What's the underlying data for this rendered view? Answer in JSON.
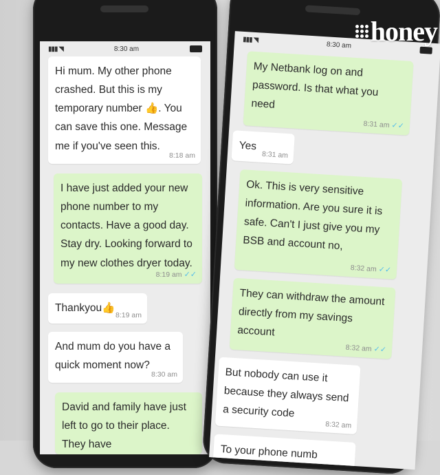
{
  "brand": {
    "logo_text": "honey"
  },
  "phone_left": {
    "status_time": "8:30 am",
    "messages": [
      {
        "dir": "in",
        "text": "Hi mum. My other phone crashed. But this is my temporary number 👍. You can save this one. Message me if you've seen this.",
        "time": "8:18 am"
      },
      {
        "dir": "out",
        "text": "I have just added your new phone number to my contacts. Have a good day. Stay dry. Looking forward to my new clothes dryer today.",
        "time": "8:19 am"
      },
      {
        "dir": "in",
        "text": "Thankyou👍",
        "time": "8:19 am"
      },
      {
        "dir": "in",
        "text": "And mum do you have a quick moment now?",
        "time": "8:30 am"
      },
      {
        "dir": "out",
        "text": "David and family have just left to go to their place. They have",
        "time": ""
      }
    ]
  },
  "phone_right": {
    "status_time": "8:30 am",
    "messages": [
      {
        "dir": "out",
        "text": "My Netbank log on and password. Is that what you need",
        "time": "8:31 am"
      },
      {
        "dir": "in",
        "text": "Yes",
        "time": "8:31 am"
      },
      {
        "dir": "out",
        "text": "Ok. This is very sensitive information. Are you sure it is safe. Can't I just give you my BSB and account no,",
        "time": "8:32 am"
      },
      {
        "dir": "out",
        "text": "They can withdraw the amount directly from my savings account",
        "time": "8:32 am"
      },
      {
        "dir": "in",
        "text": "But nobody can use it because they always send a security code",
        "time": "8:32 am"
      },
      {
        "dir": "in",
        "text": "To your phone numb",
        "time": ""
      }
    ]
  },
  "colors": {
    "incoming": "#ffffff",
    "outgoing": "#dcf5c9",
    "read_tick": "#53bdeb"
  }
}
